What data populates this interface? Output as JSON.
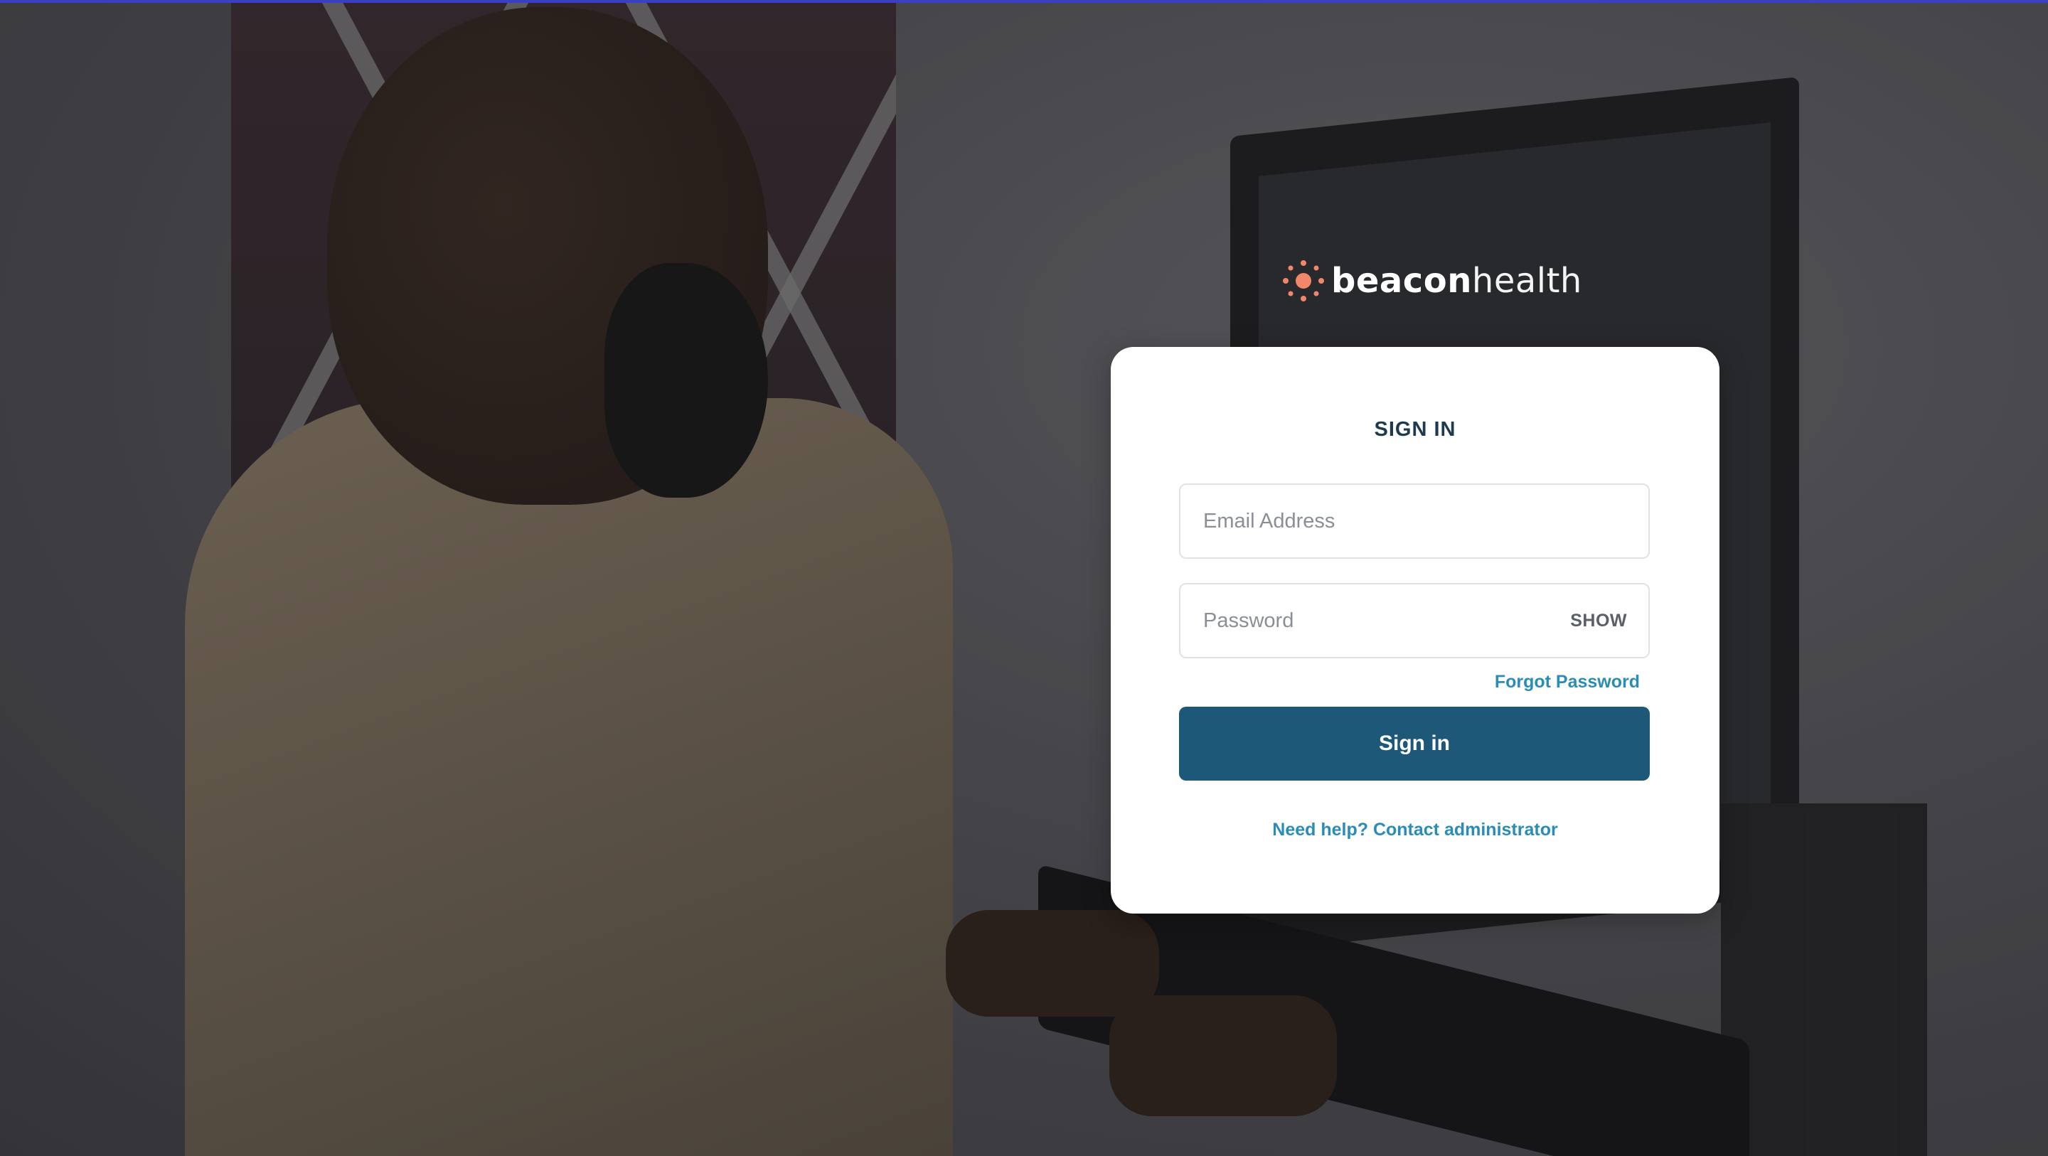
{
  "brand": {
    "name_bold": "beacon",
    "name_light": "health",
    "logo_icon": "sun-icon",
    "accent_color": "#f0876a"
  },
  "signin_card": {
    "title": "SIGN IN",
    "email": {
      "placeholder": "Email Address",
      "value": ""
    },
    "password": {
      "placeholder": "Password",
      "value": "",
      "toggle_label": "SHOW"
    },
    "forgot_password_label": "Forgot Password",
    "submit_label": "Sign in",
    "help_label": "Need help? Contact administrator"
  },
  "colors": {
    "primary_button": "#1d5878",
    "link": "#2a8cb8",
    "title": "#1e3a4e"
  }
}
